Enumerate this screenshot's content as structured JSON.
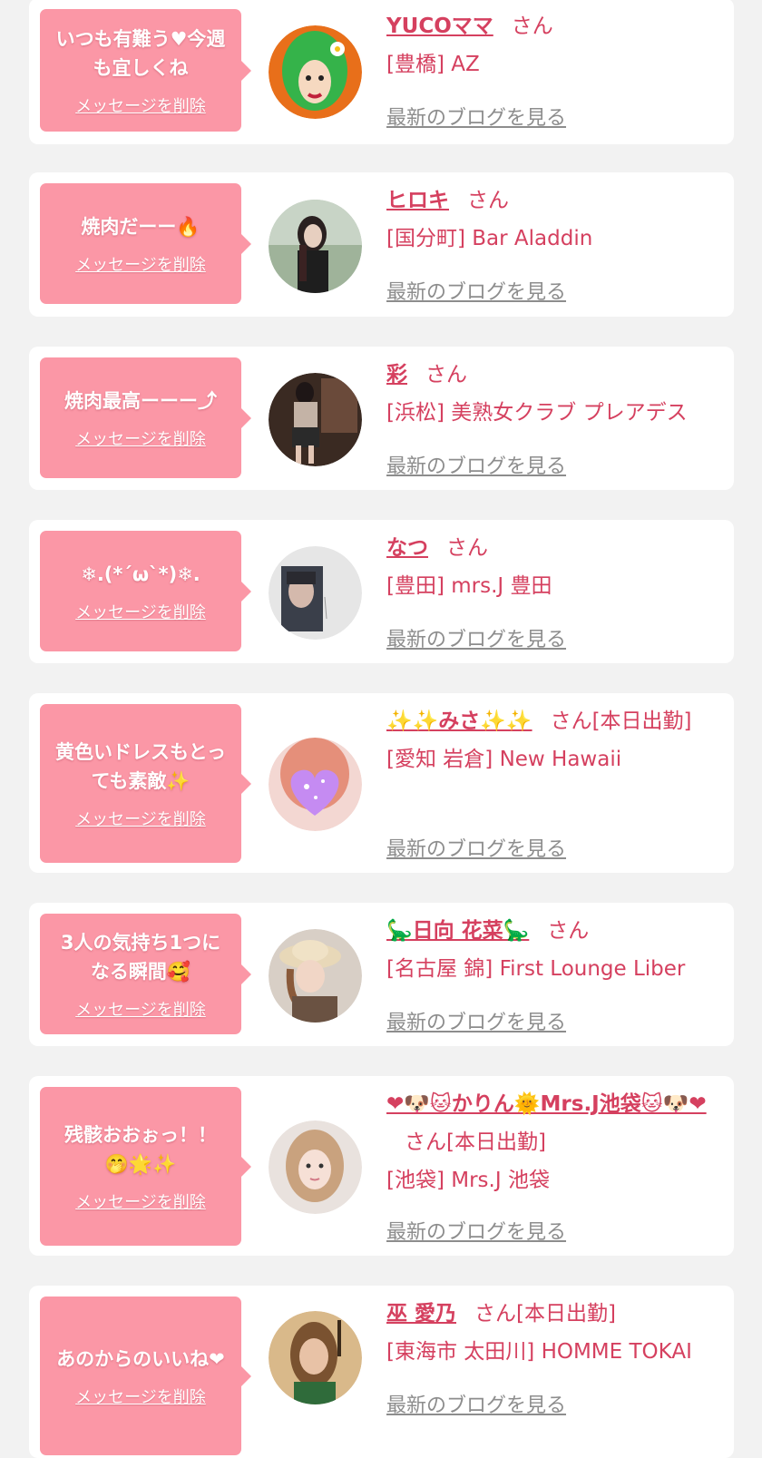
{
  "common": {
    "delete_label": "メッセージを削除",
    "san": "さん",
    "blog_label": "最新のブログを見る"
  },
  "cards": [
    {
      "message": "いつも有難う♥今週も宜しくね",
      "name": "YUCOママ",
      "san_suffix": "さん",
      "shop": "[豊橋] AZ",
      "avatar": "green-hair-illustration"
    },
    {
      "message": "焼肉だーー🔥",
      "name": "ヒロキ",
      "san_suffix": "さん",
      "shop": "[国分町] Bar Aladdin",
      "avatar": "woman-photo-dark-hair"
    },
    {
      "message": "焼肉最高ーーー⤴",
      "name": "彩",
      "san_suffix": "さん",
      "shop": "[浜松] 美熟女クラブ プレアデス",
      "avatar": "woman-sitting-photo"
    },
    {
      "message": "❄.(*´ω`*)❄.",
      "name": "なつ",
      "san_suffix": "さん",
      "shop": "[豊田] mrs.J 豊田",
      "avatar": "woman-with-sign-photo"
    },
    {
      "message": "黄色いドレスもとっても素敵✨",
      "name": "✨✨みさ✨✨",
      "san_suffix": "さん[本日出勤]",
      "shop": "[愛知 岩倉] New Hawaii",
      "avatar": "heart-face-photo"
    },
    {
      "message": "3人の気持ち1つになる瞬間🥰",
      "name": "🦕日向 花菜🦕",
      "san_suffix": "さん",
      "shop": "[名古屋 錦] First Lounge Liber",
      "avatar": "woman-hat-photo"
    },
    {
      "message": "残骸おおぉっ！！🤭🌟✨",
      "name": "❤🐶🐱かりん🌞Mrs.J池袋🐱🐶❤",
      "san_suffix": "さん[本日出勤]",
      "shop": "[池袋] Mrs.J 池袋",
      "avatar": "woman-blonde-photo"
    },
    {
      "message": "あのからのいいね❤",
      "name": "巫 愛乃",
      "san_suffix": "さん[本日出勤]",
      "shop": "[東海市 太田川] HOMME TOKAI",
      "avatar": "woman-homme-photo"
    }
  ],
  "colors": {
    "accent": "#d5405f",
    "bubble": "#fb97a6",
    "muted": "#8d8d8d"
  }
}
